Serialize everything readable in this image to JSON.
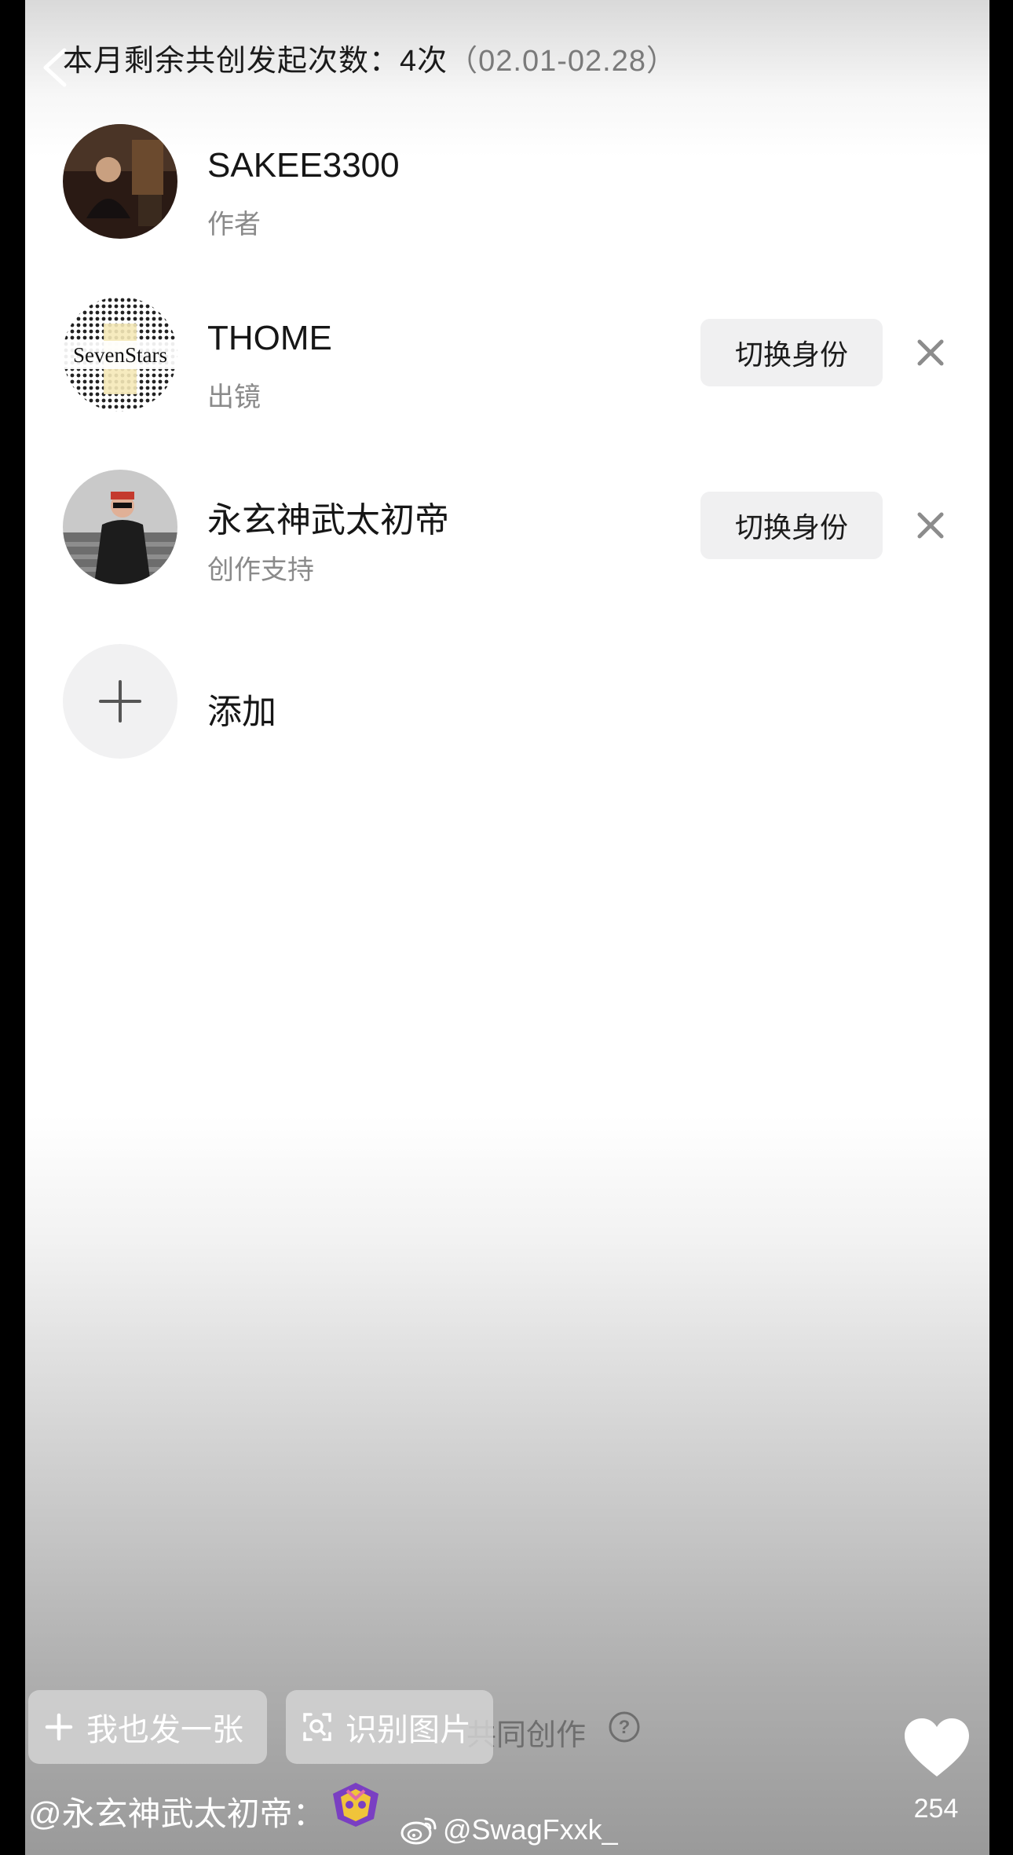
{
  "header": {
    "quota_label": "本月剩余共创发起次数：4次",
    "quota_range": "（02.01-02.28）"
  },
  "members": [
    {
      "name": "SAKEE3300",
      "role": "作者",
      "avatar_label": ""
    },
    {
      "name": "THOME",
      "role": "出镜",
      "avatar_label": "SevenStars",
      "switch_label": "切换身份"
    },
    {
      "name": "永玄神武太初帝",
      "role": "创作支持",
      "avatar_label": "",
      "switch_label": "切换身份"
    }
  ],
  "add": {
    "label": "添加"
  },
  "bottom": {
    "post_button": "我也发一张",
    "recognize_button": "识别图片",
    "faded_caption": "共同创作",
    "like_count": "254",
    "author_handle": "@永玄神武太初帝：",
    "watermark": "@SwagFxxk_"
  },
  "icons": {
    "back": "chevron-left-icon",
    "remove": "close-icon",
    "add": "plus-icon",
    "like": "heart-icon",
    "help": "question-mark-icon",
    "scan": "scan-icon",
    "watermark": "weibo-logo"
  },
  "colors": {
    "switch_button_bg": "#f0f0f1",
    "secondary_text": "#8a8a8a"
  }
}
